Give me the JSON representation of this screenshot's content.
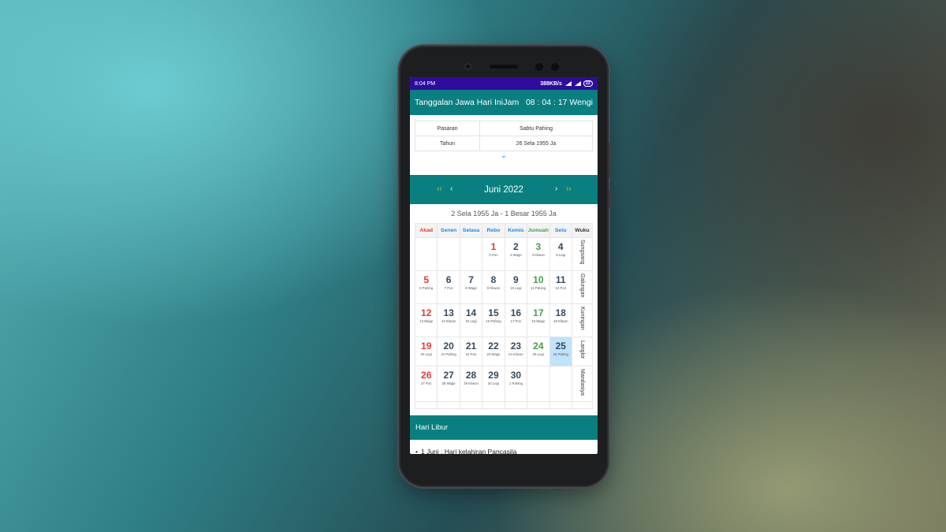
{
  "statusbar": {
    "time": "8:04 PM",
    "speed": "388KB/s",
    "battery": "22"
  },
  "appbar": {
    "title": "Tanggalan Jawa Hari Ini",
    "clock": "Jam   08 : 04 : 17 Wengi"
  },
  "info": {
    "rows": [
      {
        "key": "Pasaran",
        "value": "Sabtu Pahing"
      },
      {
        "key": "Tahun",
        "value": "26 Sela 1955 Ja"
      }
    ],
    "expand_icon": "chevron-down-icon"
  },
  "month": {
    "title": "Juni 2022",
    "prev_year": "‹‹",
    "prev_month": "‹",
    "next_month": "›",
    "next_year": "››"
  },
  "javanese_range": "2 Sela 1955 Ja - 1 Besar 1955 Ja",
  "calendar": {
    "headers": [
      {
        "label": "Akad",
        "color": "#e53935"
      },
      {
        "label": "Senen",
        "color": "#1e88e5"
      },
      {
        "label": "Selasa",
        "color": "#1e88e5"
      },
      {
        "label": "Rebo",
        "color": "#1e88e5"
      },
      {
        "label": "Kemis",
        "color": "#1e88e5"
      },
      {
        "label": "Jumuah",
        "color": "#43a047"
      },
      {
        "label": "Setu",
        "color": "#1e88e5"
      },
      {
        "label": "Wuku",
        "color": "#333333"
      }
    ],
    "weeks": [
      {
        "wuku": "Sungsang",
        "days": [
          null,
          null,
          null,
          {
            "n": "1",
            "s": "2 Pon",
            "style": "red"
          },
          {
            "n": "2",
            "s": "3 Wage"
          },
          {
            "n": "3",
            "s": "4 Kliwon",
            "style": "green"
          },
          {
            "n": "4",
            "s": "5 Legi"
          }
        ]
      },
      {
        "wuku": "Galungan",
        "days": [
          {
            "n": "5",
            "s": "6 Pahing",
            "style": "red"
          },
          {
            "n": "6",
            "s": "7 Pon"
          },
          {
            "n": "7",
            "s": "8 Wage"
          },
          {
            "n": "8",
            "s": "9 Kliwon"
          },
          {
            "n": "9",
            "s": "10 Legi"
          },
          {
            "n": "10",
            "s": "11 Pahing",
            "style": "green"
          },
          {
            "n": "11",
            "s": "12 Pon"
          }
        ]
      },
      {
        "wuku": "Kuningan",
        "days": [
          {
            "n": "12",
            "s": "13 Wage",
            "style": "red"
          },
          {
            "n": "13",
            "s": "14 Kliwon"
          },
          {
            "n": "14",
            "s": "15 Legi"
          },
          {
            "n": "15",
            "s": "16 Pahing"
          },
          {
            "n": "16",
            "s": "17 Pon"
          },
          {
            "n": "17",
            "s": "18 Wage",
            "style": "green"
          },
          {
            "n": "18",
            "s": "19 Kliwon"
          }
        ]
      },
      {
        "wuku": "Langkir",
        "days": [
          {
            "n": "19",
            "s": "20 Legi",
            "style": "red"
          },
          {
            "n": "20",
            "s": "21 Pahing"
          },
          {
            "n": "21",
            "s": "22 Pon"
          },
          {
            "n": "22",
            "s": "23 Wage"
          },
          {
            "n": "23",
            "s": "24 Kliwon"
          },
          {
            "n": "24",
            "s": "25 Legi",
            "style": "green"
          },
          {
            "n": "25",
            "s": "26 Pahing",
            "style": "today"
          }
        ]
      },
      {
        "wuku": "Mandasiya",
        "days": [
          {
            "n": "26",
            "s": "27 Pon",
            "style": "red"
          },
          {
            "n": "27",
            "s": "28 Wage"
          },
          {
            "n": "28",
            "s": "29 Kliwon"
          },
          {
            "n": "29",
            "s": "30 Legi"
          },
          {
            "n": "30",
            "s": "1 Pahing"
          },
          null,
          null
        ]
      }
    ]
  },
  "holidays": {
    "title": "Hari Libur",
    "items": [
      "1 Juni : Hari kelahiran Pancasila"
    ]
  }
}
